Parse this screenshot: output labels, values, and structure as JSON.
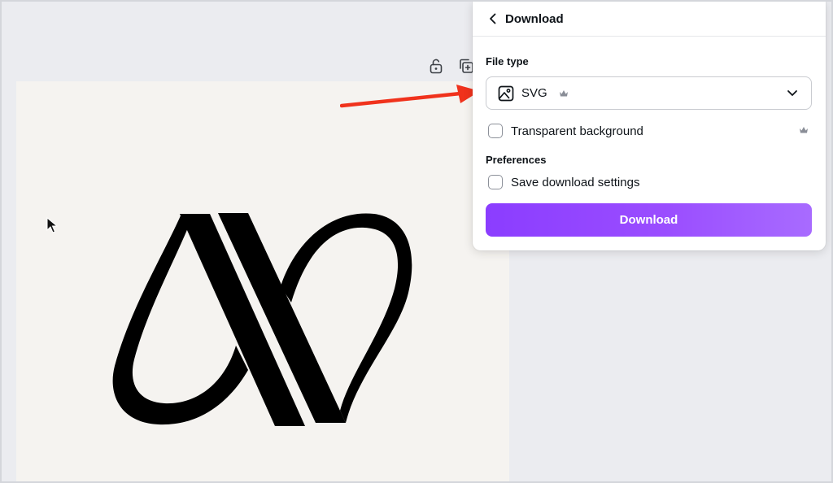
{
  "panel": {
    "title": "Download",
    "file_type_label": "File type",
    "file_type_value": "SVG",
    "transparent_background_label": "Transparent background",
    "preferences_label": "Preferences",
    "save_settings_label": "Save download settings",
    "download_button_label": "Download"
  },
  "icons": {
    "back": "chevron-left-icon",
    "file_type": "image-icon",
    "premium": "crown-icon",
    "dropdown": "chevron-down-icon",
    "lock": "lock-icon",
    "duplicate": "duplicate-page-icon",
    "cursor": "mouse-pointer-icon",
    "annotation": "red-arrow"
  },
  "colors": {
    "accent": "#8b3dff",
    "annotation_arrow": "#f0321c",
    "canvas_bg": "#f5f3f0",
    "workspace_bg": "#ebecf0"
  }
}
